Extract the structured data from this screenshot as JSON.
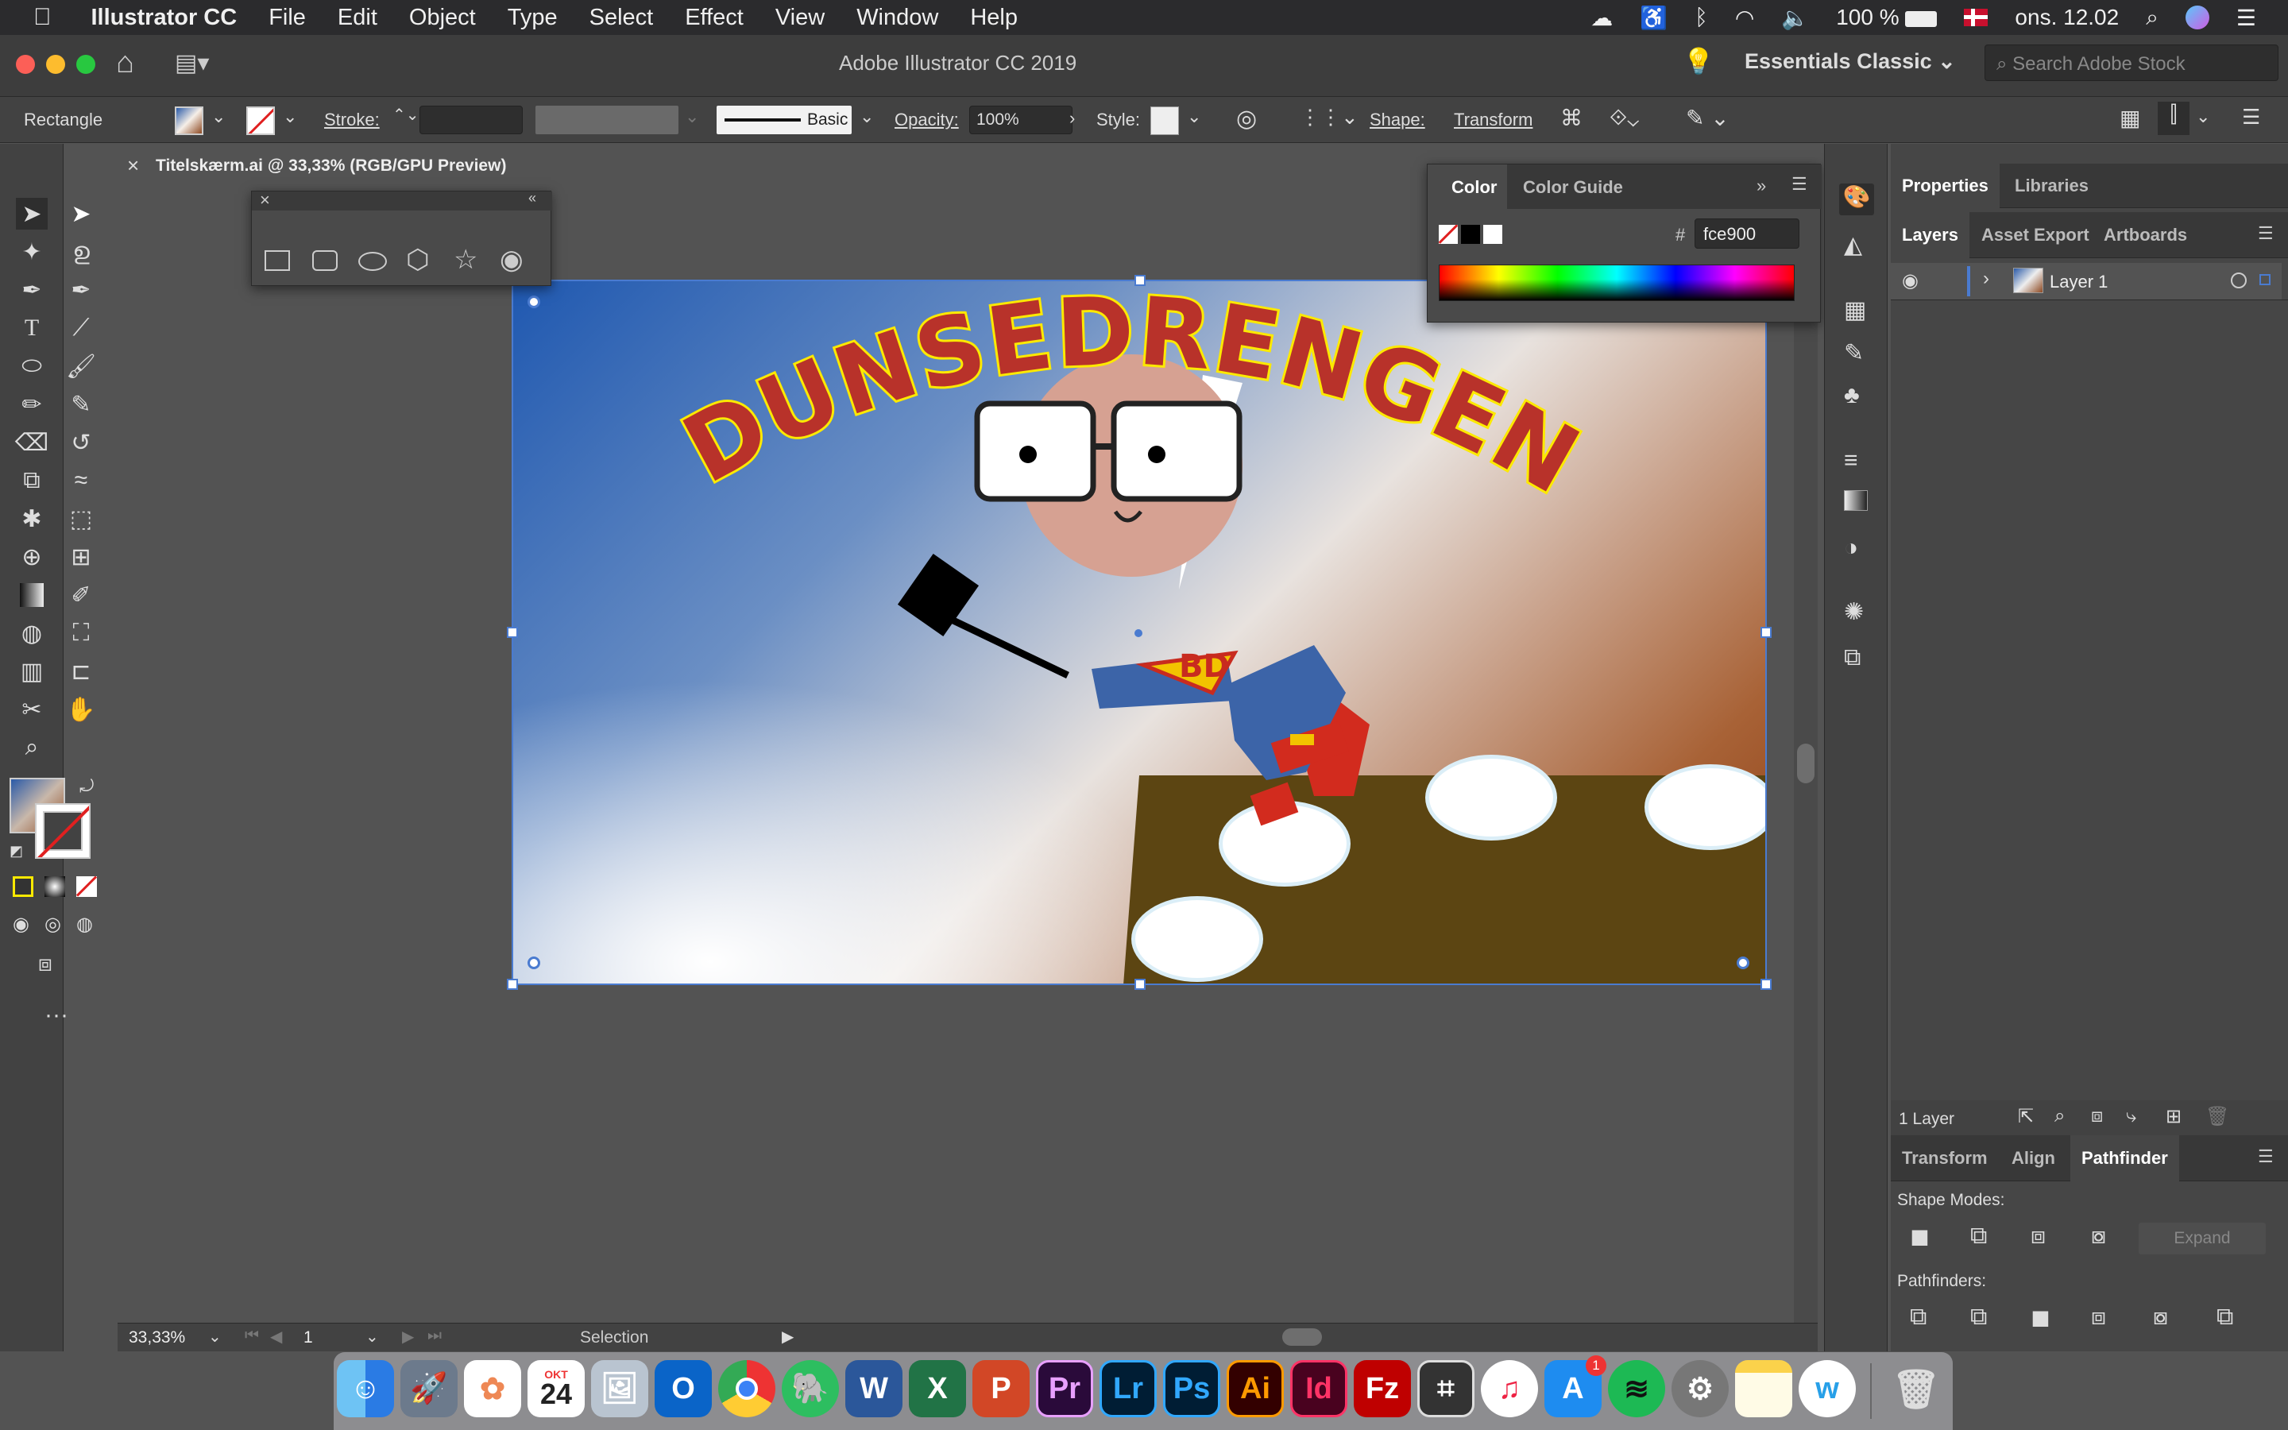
{
  "menubar": {
    "app": "Illustrator CC",
    "items": [
      "File",
      "Edit",
      "Object",
      "Type",
      "Select",
      "Effect",
      "View",
      "Window",
      "Help"
    ],
    "battery": "100 %",
    "clock": "ons. 12.02"
  },
  "titlebar": {
    "title": "Adobe Illustrator CC 2019",
    "workspace": "Essentials Classic",
    "search_placeholder": "Search Adobe Stock"
  },
  "control": {
    "selection_type": "Rectangle",
    "stroke_label": "Stroke:",
    "brush_label": "Basic",
    "opacity_label": "Opacity:",
    "opacity_value": "100%",
    "style_label": "Style:",
    "shape_label": "Shape:",
    "transform_label": "Transform"
  },
  "document": {
    "tab_title": "Titelskærm.ai @ 33,33% (RGB/GPU Preview)",
    "close": "×"
  },
  "artwork": {
    "title": "DUNSEDRENGEN",
    "emblem": "BD"
  },
  "color_panel": {
    "tab_color": "Color",
    "tab_guide": "Color Guide",
    "hex_prefix": "#",
    "hex_value": "fce900"
  },
  "right_panel": {
    "tabs_top": [
      "Properties",
      "Libraries"
    ],
    "tabs_layers": [
      "Layers",
      "Asset Export",
      "Artboards"
    ],
    "layer_name": "Layer 1",
    "layer_count": "1 Layer",
    "tabs_bottom": [
      "Transform",
      "Align",
      "Pathfinder"
    ],
    "shape_modes_label": "Shape Modes:",
    "expand_label": "Expand",
    "pathfinders_label": "Pathfinders:"
  },
  "statusbar": {
    "zoom": "33,33%",
    "artboard_num": "1",
    "status_text": "Selection"
  },
  "dock": {
    "calendar_month": "OKT",
    "calendar_day": "24",
    "badge": "1",
    "apps": [
      "Finder",
      "Launchpad",
      "Photos",
      "Calendar",
      "Preview",
      "Outlook",
      "Chrome",
      "Evernote",
      "Word",
      "Excel",
      "PowerPoint",
      "Premiere Pro",
      "Lightroom",
      "Photoshop",
      "Illustrator",
      "InDesign",
      "FileZilla",
      "Capacitor",
      "iTunes",
      "App Store",
      "Spotify",
      "System Preferences",
      "Notes",
      "Wunderlist",
      "Trash"
    ],
    "labels": {
      "pr": "Pr",
      "lr": "Lr",
      "ps": "Ps",
      "ai": "Ai",
      "id": "Id",
      "fz": "Fz",
      "w": "W",
      "x": "X",
      "p": "P",
      "o": "O"
    }
  },
  "colors": {
    "accent_blue": "#4a7bd0",
    "title_red": "#b8322a",
    "title_yellow": "#fce900"
  }
}
